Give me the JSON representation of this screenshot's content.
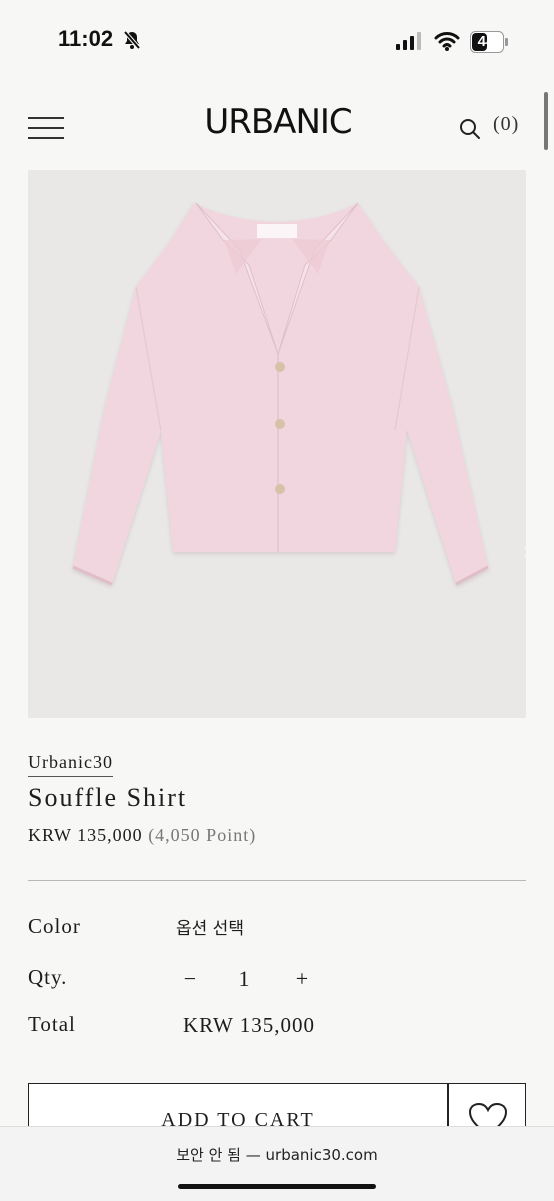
{
  "status": {
    "time": "11:02",
    "battery": "44"
  },
  "header": {
    "logo": "URBANIC",
    "cart_count": "(0)"
  },
  "product": {
    "brand": "Urbanic30",
    "name": "Souffle Shirt",
    "price": "KRW 135,000",
    "points": "(4,050 Point)"
  },
  "options": {
    "color_label": "Color",
    "color_value": "옵션 선택",
    "qty_label": "Qty.",
    "qty_minus": "−",
    "qty_value": "1",
    "qty_plus": "+",
    "total_label": "Total",
    "total_value": "KRW 135,000"
  },
  "actions": {
    "add_to_cart": "ADD TO CART"
  },
  "browser": {
    "security_text": "보안 안 됨 — urbanic30.com"
  },
  "icons": {
    "menu": "hamburger-icon",
    "search": "search-icon",
    "wishlist": "heart-icon",
    "next": "chevron-right-icon"
  },
  "colors": {
    "shirt": "#f1d6df",
    "image_background": "#e9e8e6",
    "text": "#1d1d1d"
  }
}
